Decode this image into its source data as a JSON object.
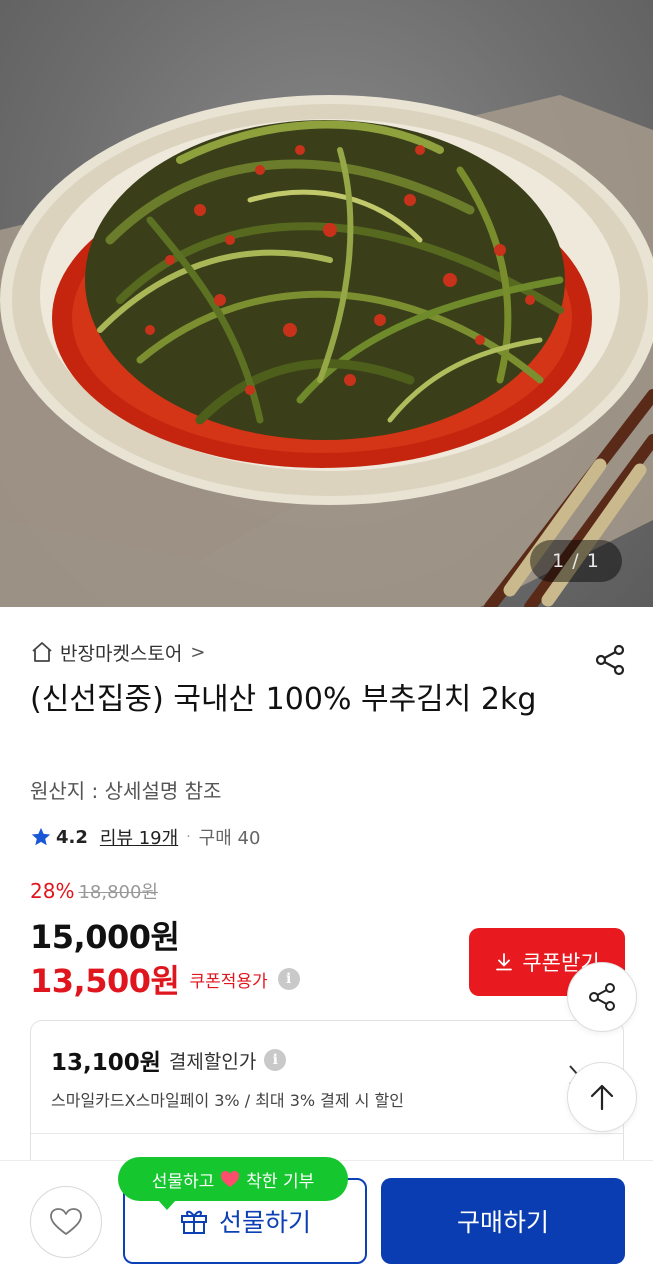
{
  "hero": {
    "image_label": "kimchi-product-photo",
    "counter": "1 / 1"
  },
  "store": {
    "icon": "home-icon",
    "name": "반장마켓스토어",
    "chevron": ">"
  },
  "product": {
    "title": "(신선집중) 국내산 100% 부추김치 2kg",
    "origin": "원산지 : 상세설명 참조"
  },
  "rating": {
    "score": "4.2",
    "reviews": "리뷰 19개",
    "separator": "·",
    "purchases": "구매 40"
  },
  "pricing": {
    "discount_rate": "28%",
    "original_price": "18,800원",
    "price": "15,000원",
    "coupon_price": "13,500원",
    "coupon_label": "쿠폰적용가",
    "info_glyph": "i"
  },
  "coupon_button": {
    "label": "쿠폰받기"
  },
  "payment": {
    "price": "13,100원",
    "label": "결제할인가",
    "description": "스마일카드X스마일페이 3% / 최대 3% 결제 시 할인"
  },
  "bottom": {
    "gift_tooltip_before": "선물하고",
    "gift_tooltip_after": "착한 기부",
    "gift_label": "선물하기",
    "buy_label": "구매하기"
  },
  "colors": {
    "accent_red": "#e8191f",
    "brand_blue": "#0a3db1",
    "tooltip_green": "#16c62e"
  }
}
